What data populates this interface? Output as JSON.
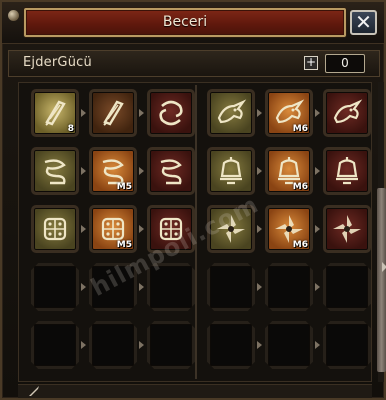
{
  "window": {
    "title": "Beceri",
    "close_label": "✕"
  },
  "header": {
    "ability_name": "EjderGücü",
    "plus_label": "+",
    "points": "0"
  },
  "colors": {
    "title_plate": "#6e1f12",
    "title_border": "#b99a62",
    "panel_bg": "#14110d",
    "slot_olive": "#857a3f",
    "slot_brown": "#7a4a28",
    "slot_maroon": "#6e2a23",
    "slot_orange": "#d98a3a"
  },
  "skills": [
    {
      "icon": "scroll-quill-icon",
      "style": "olive-hi",
      "level": "8"
    },
    {
      "icon": "scroll-quill-icon",
      "style": "brown",
      "level": ""
    },
    {
      "icon": "swirl-glyph-icon",
      "style": "maroon",
      "level": ""
    },
    {
      "icon": "dragon-head-icon",
      "style": "olive",
      "level": ""
    },
    {
      "icon": "dragon-head-icon",
      "style": "orange",
      "level": "M6"
    },
    {
      "icon": "dragon-head-icon",
      "style": "maroon",
      "level": ""
    },
    {
      "icon": "coiled-dragon-icon",
      "style": "olive",
      "level": ""
    },
    {
      "icon": "coiled-dragon-icon",
      "style": "orange",
      "level": "M5"
    },
    {
      "icon": "coiled-dragon-icon",
      "style": "maroon",
      "level": ""
    },
    {
      "icon": "bell-totem-icon",
      "style": "olive",
      "level": ""
    },
    {
      "icon": "bell-totem-icon",
      "style": "orange",
      "level": "M6"
    },
    {
      "icon": "bell-totem-icon",
      "style": "maroon",
      "level": ""
    },
    {
      "icon": "shield-grid-icon",
      "style": "olive",
      "level": ""
    },
    {
      "icon": "shield-grid-icon",
      "style": "orange",
      "level": "M5"
    },
    {
      "icon": "shield-grid-icon",
      "style": "maroon",
      "level": ""
    },
    {
      "icon": "shuriken-icon",
      "style": "olive",
      "level": ""
    },
    {
      "icon": "shuriken-icon",
      "style": "orange",
      "level": "M6"
    },
    {
      "icon": "shuriken-icon",
      "style": "maroon",
      "level": ""
    }
  ],
  "empty_slot_icon": "empty-slot",
  "watermark": "hilmpoli.com"
}
